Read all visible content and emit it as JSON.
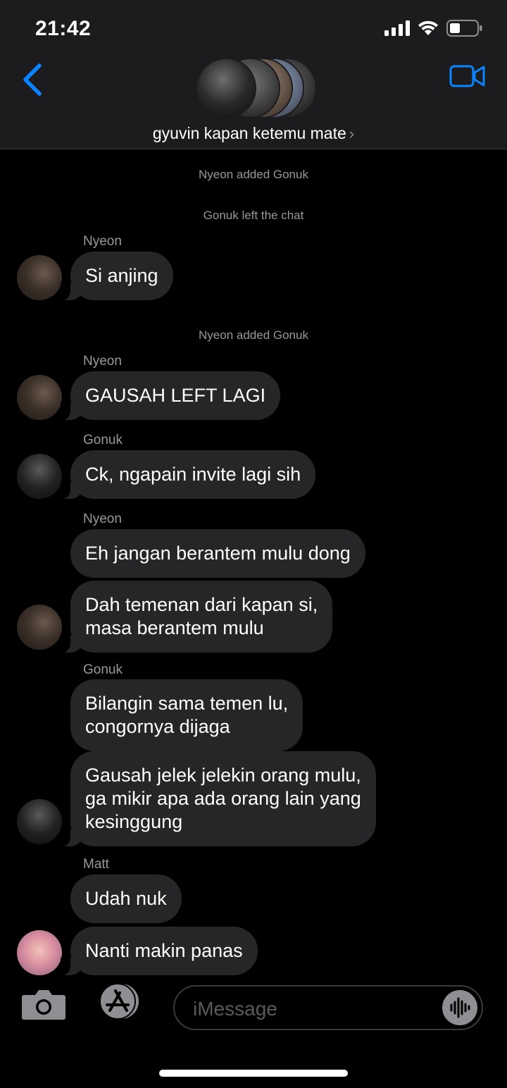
{
  "status_bar": {
    "time": "21:42"
  },
  "header": {
    "group_name": "gyuvin kapan ketemu mate",
    "chevron": "›"
  },
  "messages": {
    "sys1": "Nyeon added Gonuk",
    "sys2": "Gonuk left the chat",
    "sender1": "Nyeon",
    "m1": "Si anjing",
    "sys3": "Nyeon added Gonuk",
    "sender2": "Nyeon",
    "m2": "GAUSAH LEFT LAGI",
    "sender3": "Gonuk",
    "m3": "Ck, ngapain invite lagi sih",
    "sender4": "Nyeon",
    "m4": "Eh jangan berantem mulu dong",
    "m5_line1": "Dah temenan dari kapan si,",
    "m5_line2": "masa berantem mulu",
    "sender5": "Gonuk",
    "m6_line1": "Bilangin sama temen lu,",
    "m6_line2": "congornya dijaga",
    "m7_line1": "Gausah jelek jelekin orang mulu,",
    "m7_line2": "ga mikir apa ada orang lain yang",
    "m7_line3": "kesinggung",
    "sender6": "Matt",
    "m8": "Udah nuk",
    "m9": "Nanti makin panas"
  },
  "input": {
    "placeholder": "iMessage"
  },
  "colors": {
    "accent": "#0a84ff",
    "bubble": "#262628",
    "header_bg": "#1c1c1e",
    "meta_text": "#98989d"
  },
  "icons": [
    "back-chevron-icon",
    "video-camera-icon",
    "camera-icon",
    "app-store-icon",
    "audio-waveform-icon",
    "signal-icon",
    "wifi-icon",
    "battery-icon"
  ]
}
